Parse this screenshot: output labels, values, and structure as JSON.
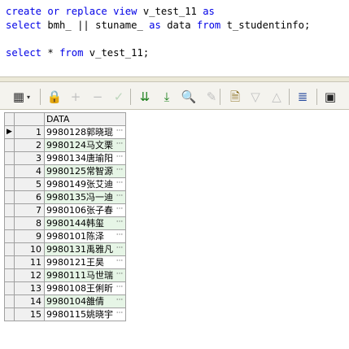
{
  "editor": {
    "lines": [
      [
        {
          "t": "create",
          "c": "kw"
        },
        {
          "t": " "
        },
        {
          "t": "or",
          "c": "kw"
        },
        {
          "t": " "
        },
        {
          "t": "replace",
          "c": "kw"
        },
        {
          "t": " "
        },
        {
          "t": "view",
          "c": "kw"
        },
        {
          "t": " "
        },
        {
          "t": "v_test_11",
          "c": "id"
        },
        {
          "t": " "
        },
        {
          "t": "as",
          "c": "kw"
        }
      ],
      [
        {
          "t": "select",
          "c": "kw"
        },
        {
          "t": " "
        },
        {
          "t": "bmh_",
          "c": "id"
        },
        {
          "t": " "
        },
        {
          "t": "||",
          "c": "sym"
        },
        {
          "t": " "
        },
        {
          "t": "stuname_",
          "c": "id"
        },
        {
          "t": " "
        },
        {
          "t": "as",
          "c": "kw"
        },
        {
          "t": " "
        },
        {
          "t": "data",
          "c": "id"
        },
        {
          "t": " "
        },
        {
          "t": "from",
          "c": "kw"
        },
        {
          "t": " "
        },
        {
          "t": "t_studentinfo",
          "c": "id"
        },
        {
          "t": ";",
          "c": "sym"
        }
      ],
      [],
      [
        {
          "t": "select",
          "c": "kw"
        },
        {
          "t": " "
        },
        {
          "t": "*",
          "c": "sym"
        },
        {
          "t": " "
        },
        {
          "t": "from",
          "c": "kw"
        },
        {
          "t": " "
        },
        {
          "t": "v_test_11",
          "c": "id"
        },
        {
          "t": ";",
          "c": "sym"
        }
      ]
    ]
  },
  "toolbar": {
    "buttons": [
      {
        "name": "grid-layout-icon",
        "glyph": "▦",
        "color": "#333333"
      },
      {
        "name": "lock-icon",
        "glyph": "🔒",
        "color": "#555555"
      },
      {
        "name": "add-record-icon",
        "glyph": "+",
        "color": "#c0c0c0"
      },
      {
        "name": "delete-record-icon",
        "glyph": "−",
        "color": "#c0c0c0"
      },
      {
        "name": "post-changes-icon",
        "glyph": "✓",
        "color": "#bcd6bc"
      },
      {
        "name": "fetch-next-icon",
        "glyph": "⇊",
        "color": "#1a7f1a"
      },
      {
        "name": "fetch-last-icon",
        "glyph": "⤓",
        "color": "#1a7f1a"
      },
      {
        "name": "query-by-example-icon",
        "glyph": "🔍",
        "color": "#333333"
      },
      {
        "name": "clear-icon",
        "glyph": "✎",
        "color": "#c0c0c0"
      },
      {
        "name": "export-icon",
        "glyph": "🗎",
        "color": "#8a6d1a"
      },
      {
        "name": "sort-desc-icon",
        "glyph": "▽",
        "color": "#c0c0c0"
      },
      {
        "name": "sort-asc-icon",
        "glyph": "△",
        "color": "#c0c0c0"
      },
      {
        "name": "connect-icon",
        "glyph": "≣",
        "color": "#2a4ea0"
      },
      {
        "name": "save-icon",
        "glyph": "▣",
        "color": "#222222"
      }
    ]
  },
  "grid": {
    "column_header": "DATA",
    "rows": [
      {
        "n": "1",
        "value": "9980128郭晓琨"
      },
      {
        "n": "2",
        "value": "9980124马文栗"
      },
      {
        "n": "3",
        "value": "9980134唐瑜阳"
      },
      {
        "n": "4",
        "value": "9980125常智源"
      },
      {
        "n": "5",
        "value": "9980149张艾迪"
      },
      {
        "n": "6",
        "value": "9980135冯一迪"
      },
      {
        "n": "7",
        "value": "9980106张子春"
      },
      {
        "n": "8",
        "value": "9980144韩玺"
      },
      {
        "n": "9",
        "value": "9980101陈泽"
      },
      {
        "n": "10",
        "value": "9980131禹雅凡"
      },
      {
        "n": "11",
        "value": "9980121王昊"
      },
      {
        "n": "12",
        "value": "9980111马世瑞"
      },
      {
        "n": "13",
        "value": "9980108王俐昕"
      },
      {
        "n": "14",
        "value": "9980104雒倩"
      },
      {
        "n": "15",
        "value": "9980115姚晓宇"
      }
    ],
    "more_glyph": "···",
    "current_row_marker": "▶"
  }
}
